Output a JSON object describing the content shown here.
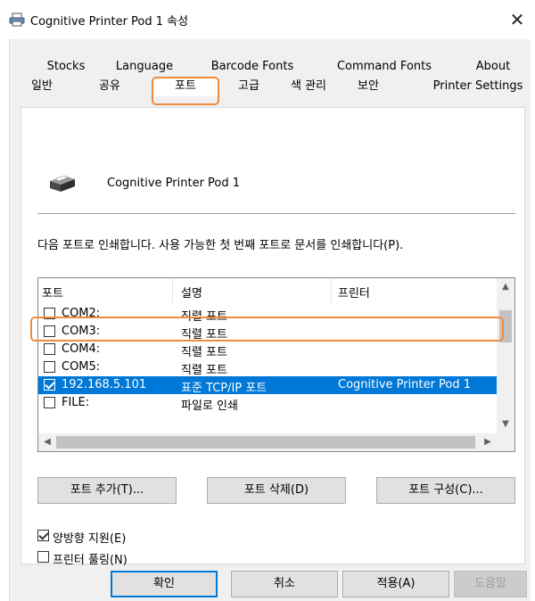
{
  "window": {
    "title": "Cognitive Printer Pod 1 속성",
    "close_glyph": "✕"
  },
  "tabs": {
    "row1": [
      "Stocks",
      "Language",
      "Barcode Fonts",
      "Command Fonts",
      "About"
    ],
    "row2": [
      "일반",
      "공유",
      "포트",
      "고급",
      "색 관리",
      "보안",
      "Printer Settings"
    ],
    "active": "포트"
  },
  "panel": {
    "printer_name": "Cognitive Printer Pod 1",
    "instruction": "다음 포트로 인쇄합니다. 사용 가능한 첫 번째 포트로 문서를 인쇄합니다(P).",
    "columns": [
      "포트",
      "설명",
      "프린터"
    ],
    "ports": [
      {
        "port": "COM2:",
        "desc": "직렬 포트",
        "printer": "",
        "checked": false
      },
      {
        "port": "COM3:",
        "desc": "직렬 포트",
        "printer": "",
        "checked": false
      },
      {
        "port": "COM4:",
        "desc": "직렬 포트",
        "printer": "",
        "checked": false
      },
      {
        "port": "COM5:",
        "desc": "직렬 포트",
        "printer": "",
        "checked": false
      },
      {
        "port": "192.168.5.101",
        "desc": "표준 TCP/IP 포트",
        "printer": "Cognitive Printer Pod 1",
        "checked": true,
        "selected": true
      },
      {
        "port": "FILE:",
        "desc": "파일로 인쇄",
        "printer": "",
        "checked": false
      }
    ],
    "buttons": {
      "add": "포트 추가(T)...",
      "delete": "포트 삭제(D)",
      "configure": "포트 구성(C)..."
    },
    "options": {
      "bidirectional": {
        "label": "양방향 지원(E)",
        "checked": true
      },
      "pooling": {
        "label": "프린터 풀링(N)",
        "checked": false
      }
    }
  },
  "footer": {
    "ok": "확인",
    "cancel": "취소",
    "apply": "적용(A)",
    "help": "도움말"
  },
  "colors": {
    "accent": "#0078d7",
    "highlight": "#f08a3c"
  }
}
